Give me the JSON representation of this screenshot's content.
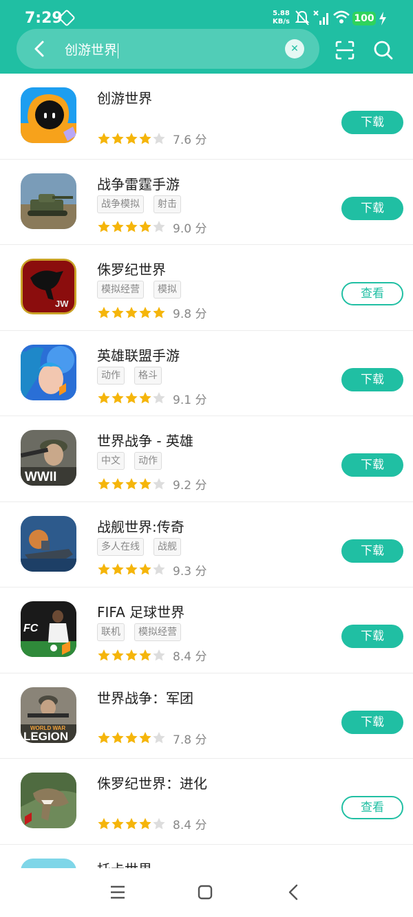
{
  "status_bar": {
    "time": "7:29",
    "net_speed_value": "5.88",
    "net_speed_unit": "KB/s",
    "battery": "100"
  },
  "search": {
    "query": "创游世界"
  },
  "colors": {
    "accent": "#20bfa3",
    "star": "#f5b50a",
    "star_empty": "#dddddd"
  },
  "results": [
    {
      "name": "创游世界",
      "tags": [],
      "rating": "7.6 分",
      "stars": 4,
      "button": "下载",
      "button_type": "dl"
    },
    {
      "name": "战争雷霆手游",
      "tags": [
        "战争模拟",
        "射击"
      ],
      "rating": "9.0 分",
      "stars": 4.5,
      "button": "下载",
      "button_type": "dl"
    },
    {
      "name": "侏罗纪世界",
      "tags": [
        "模拟经营",
        "模拟"
      ],
      "rating": "9.8 分",
      "stars": 5,
      "button": "查看",
      "button_type": "view"
    },
    {
      "name": "英雄联盟手游",
      "tags": [
        "动作",
        "格斗"
      ],
      "rating": "9.1 分",
      "stars": 4.5,
      "button": "下载",
      "button_type": "dl"
    },
    {
      "name": "世界战争 - 英雄",
      "tags": [
        "中文",
        "动作"
      ],
      "rating": "9.2 分",
      "stars": 4.5,
      "button": "下载",
      "button_type": "dl"
    },
    {
      "name": "战舰世界:传奇",
      "tags": [
        "多人在线",
        "战舰"
      ],
      "rating": "9.3 分",
      "stars": 4.5,
      "button": "下载",
      "button_type": "dl"
    },
    {
      "name": "FIFA 足球世界",
      "tags": [
        "联机",
        "模拟经营"
      ],
      "rating": "8.4 分",
      "stars": 4,
      "button": "下载",
      "button_type": "dl"
    },
    {
      "name": "世界战争：军团",
      "tags": [],
      "rating": "7.8 分",
      "stars": 4,
      "button": "下载",
      "button_type": "dl"
    },
    {
      "name": "侏罗纪世界：进化",
      "tags": [],
      "rating": "8.4 分",
      "stars": 4,
      "button": "查看",
      "button_type": "view"
    },
    {
      "name": "托卡世界",
      "tags": [],
      "rating": "",
      "stars": 0,
      "button": "",
      "button_type": ""
    }
  ],
  "icon_text": {
    "jw": "JW",
    "wwii": "WWII",
    "world_war": "WORLD WAR",
    "legion": "LEGION",
    "fc": "FC"
  }
}
